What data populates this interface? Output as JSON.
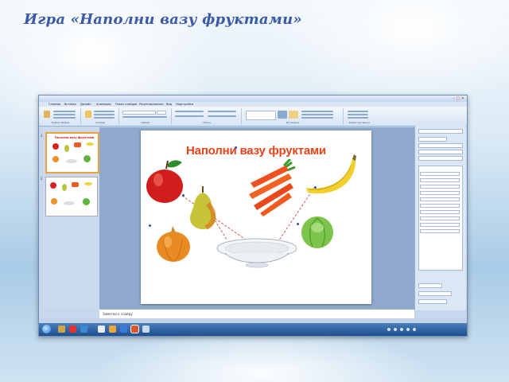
{
  "page": {
    "title": "Игра «Наполни вазу фруктами»"
  },
  "window": {
    "title": "",
    "tabs": [
      "Главная",
      "Вставка",
      "Дизайн",
      "Анимация",
      "Показ слайдов",
      "Рецензирование",
      "Вид",
      "Надстройки"
    ],
    "ribbon_groups": [
      "Буфер обмена",
      "Слайды",
      "Шрифт",
      "Абзац",
      "Рисование",
      "Редактирование"
    ]
  },
  "slide": {
    "heading": "Наполни вазу фруктами",
    "items": [
      "apple",
      "pear",
      "carrots",
      "banana",
      "onion",
      "cabbage",
      "vase"
    ]
  },
  "slides_panel": {
    "thumbs": [
      {
        "number": "1",
        "title": "Наполни вазу фруктами"
      },
      {
        "number": "2",
        "title": ""
      }
    ]
  },
  "notes": {
    "text": "Заметки к слайду"
  },
  "colors": {
    "title": "#3a5aa8",
    "heading": "#e8421a",
    "selection": "#f2a23a",
    "taskbar": "#1d4f8c"
  },
  "icons": [
    "windows-start-icon",
    "internet-explorer-icon",
    "explorer-icon",
    "media-player-icon",
    "powerpoint-icon",
    "word-icon"
  ]
}
